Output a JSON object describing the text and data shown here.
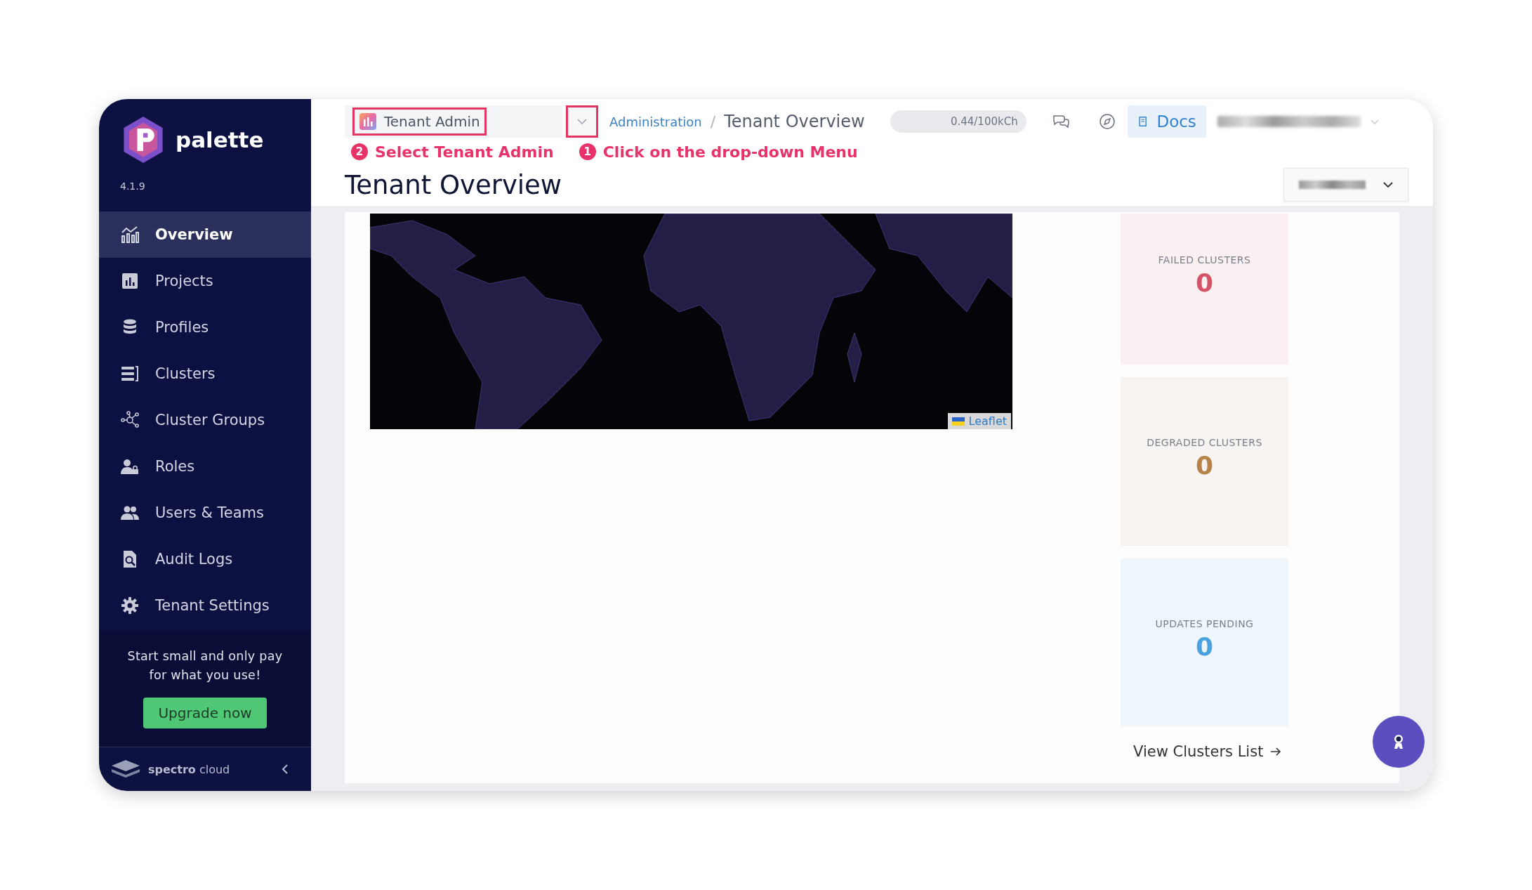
{
  "sidebar": {
    "brand": "palette",
    "version": "4.1.9",
    "items": [
      {
        "label": "Overview",
        "selected": true
      },
      {
        "label": "Projects",
        "selected": false
      },
      {
        "label": "Profiles",
        "selected": false
      },
      {
        "label": "Clusters",
        "selected": false
      },
      {
        "label": "Cluster Groups",
        "selected": false
      },
      {
        "label": "Roles",
        "selected": false
      },
      {
        "label": "Users & Teams",
        "selected": false
      },
      {
        "label": "Audit Logs",
        "selected": false
      },
      {
        "label": "Tenant Settings",
        "selected": false
      }
    ],
    "promo": "Start small and only pay for what you use!",
    "upgrade_button": "Upgrade now",
    "footer_brand": "**spectro** cloud"
  },
  "topbar": {
    "scope_select": "Tenant Admin",
    "breadcrumb": [
      "Administration",
      "Tenant Overview"
    ],
    "breadcrumb_separator": "/",
    "usage": "0.44/100kCh",
    "docs_button": "Docs"
  },
  "annotations": [
    {
      "number": "2",
      "text": "Select Tenant Admin"
    },
    {
      "number": "1",
      "text": "Click on the drop-down Menu"
    }
  ],
  "page_title": "Tenant Overview",
  "map": {
    "attribution": "Leaflet"
  },
  "stats": [
    {
      "label": "FAILED CLUSTERS",
      "value": "0",
      "color": "#d65468"
    },
    {
      "label": "DEGRADED CLUSTERS",
      "value": "0",
      "color": "#b8834a"
    },
    {
      "label": "UPDATES PENDING",
      "value": "0",
      "color": "#4aa3de"
    }
  ],
  "view_clusters_link": "View Clusters List"
}
